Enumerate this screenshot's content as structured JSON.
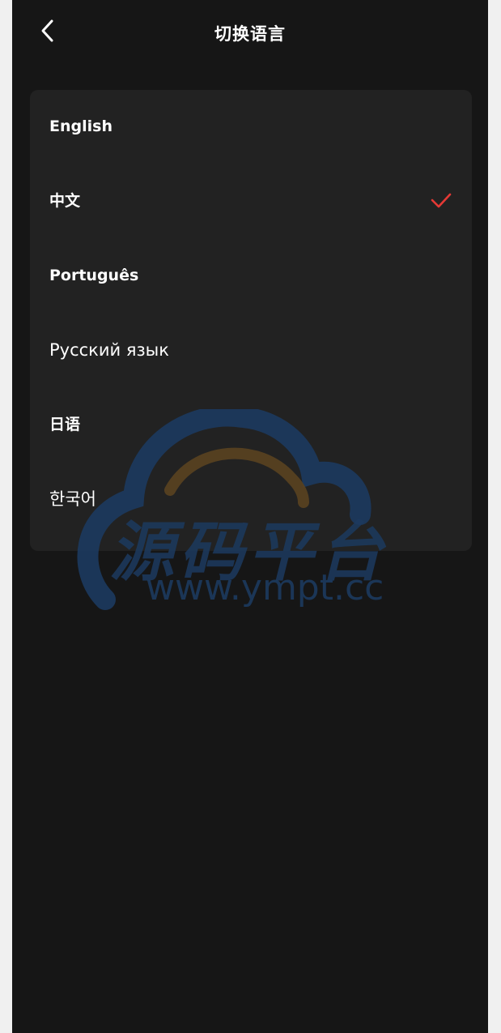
{
  "header": {
    "title": "切换语言",
    "back_icon": "chevron-left-icon"
  },
  "languages": [
    {
      "label": "English",
      "selected": false
    },
    {
      "label": "中文",
      "selected": true
    },
    {
      "label": "Português",
      "selected": false
    },
    {
      "label": "Русский язык",
      "selected": false
    },
    {
      "label": "日语",
      "selected": false
    },
    {
      "label": "한국어",
      "selected": false
    }
  ],
  "check_icon": "checkmark-icon",
  "colors": {
    "background": "#161616",
    "card": "#222222",
    "text": "#ffffff",
    "accent": "#e53935"
  },
  "watermark": {
    "title": "源码平台",
    "url": "www.ympt.cc"
  }
}
